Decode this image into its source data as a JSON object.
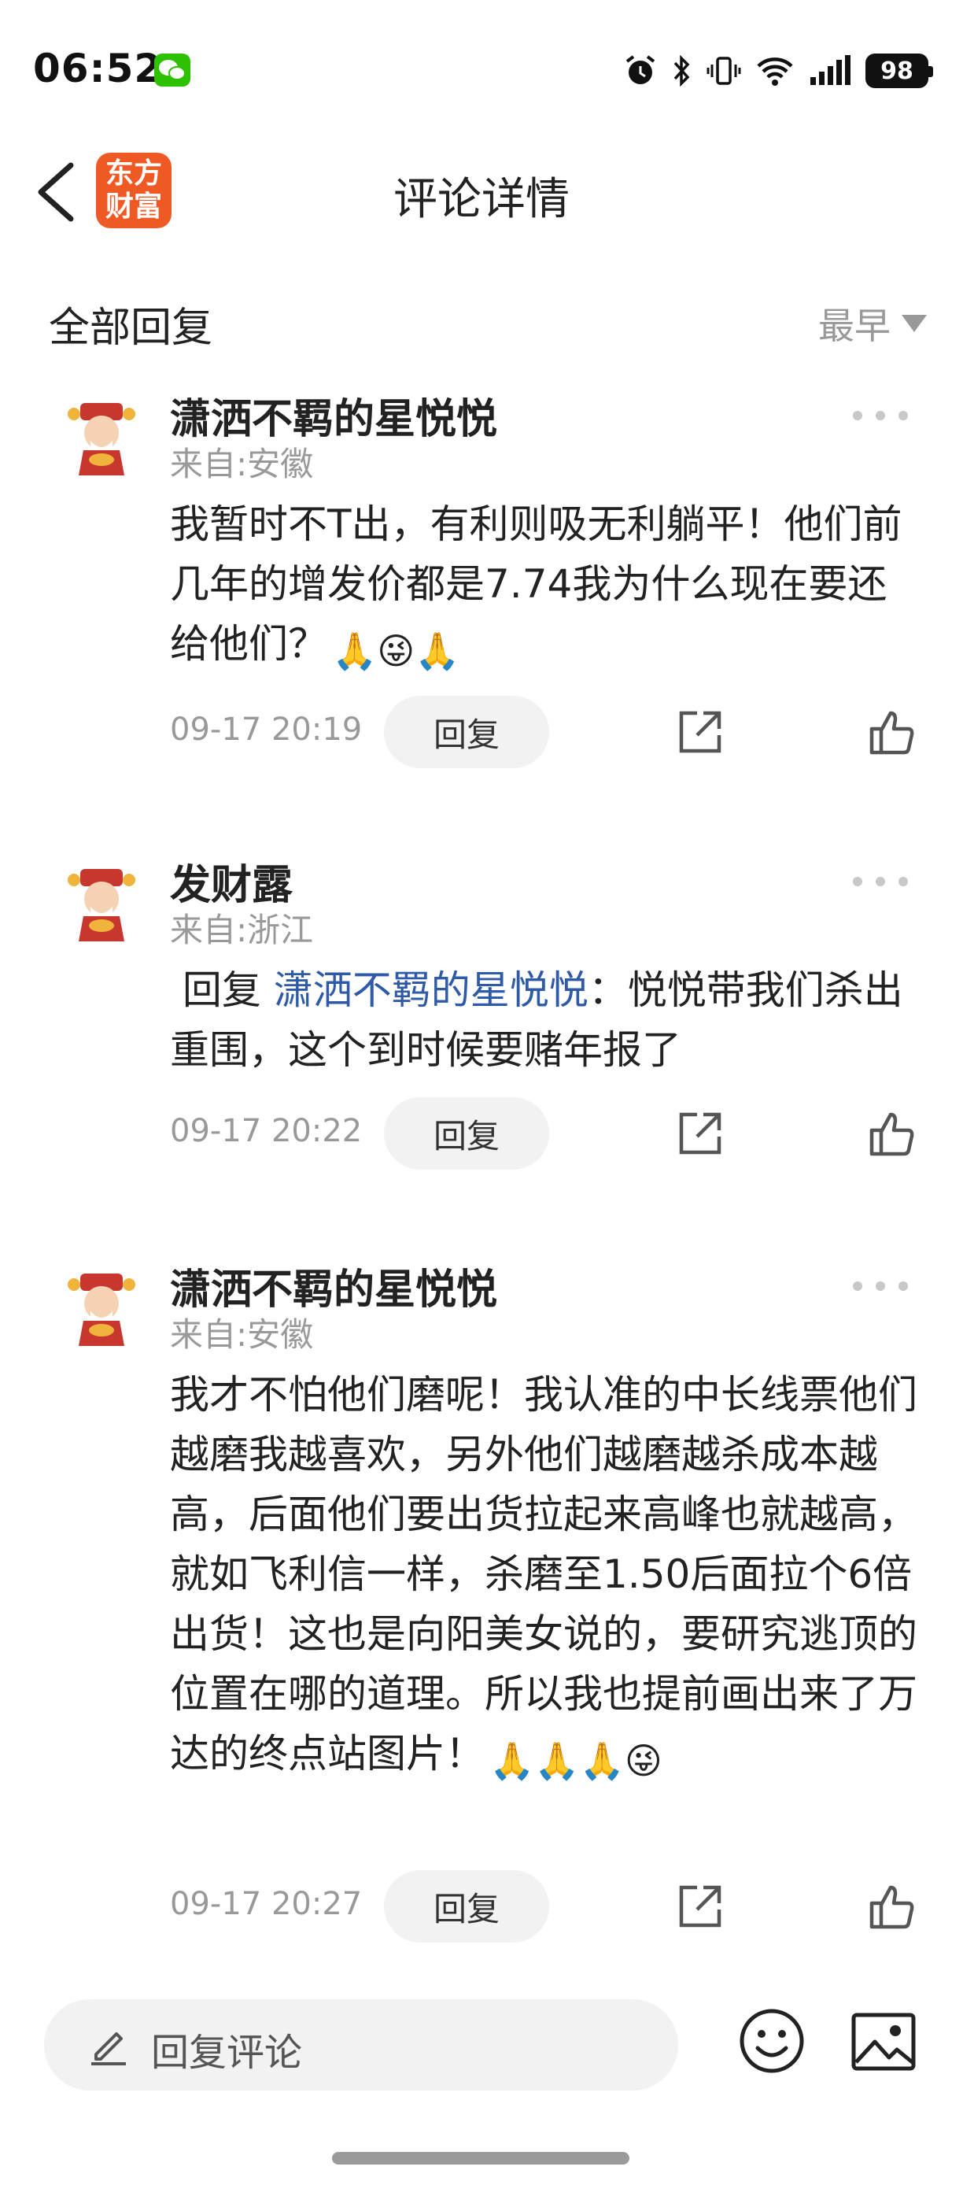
{
  "status_bar": {
    "time": "06:52",
    "battery": "98",
    "icons": [
      "wechat-icon",
      "alarm-icon",
      "bluetooth-icon",
      "vibrate-icon",
      "wifi-icon",
      "signal-icon",
      "battery-icon"
    ]
  },
  "header": {
    "logo_line1": "东方",
    "logo_line2": "财富",
    "title": "评论详情"
  },
  "sort_row": {
    "label": "全部回复",
    "sort": "最早"
  },
  "comments": [
    {
      "user": "潇洒不羁的星悦悦",
      "location": "来自:安徽",
      "text": "我暂时不T出，有利则吸无利躺平！他们前几年的增发价都是7.74我为什么现在要还给他们？",
      "emojis": "🙏😜🙏",
      "time": "09-17 20:19",
      "reply_label": "回复"
    },
    {
      "user": "发财露",
      "location": "来自:浙江",
      "reply_prefix": "回复",
      "reply_to": "潇洒不羁的星悦悦",
      "text": "：悦悦带我们杀出重围，这个到时候要赌年报了",
      "time": "09-17 20:22",
      "reply_label": "回复"
    },
    {
      "user": "潇洒不羁的星悦悦",
      "location": "来自:安徽",
      "text": "我才不怕他们磨呢！我认准的中长线票他们越磨我越喜欢，另外他们越磨越杀成本越高，后面他们要出货拉起来高峰也就越高，就如飞利信一样，杀磨至1.50后面拉个6倍出货！这也是向阳美女说的，要研究逃顶的位置在哪的道理。所以我也提前画出来了万达的终点站图片！",
      "emojis": "🙏🙏🙏😜",
      "time": "09-17 20:27",
      "reply_label": "回复"
    }
  ],
  "bottom_bar": {
    "input_label": "回复评论"
  }
}
